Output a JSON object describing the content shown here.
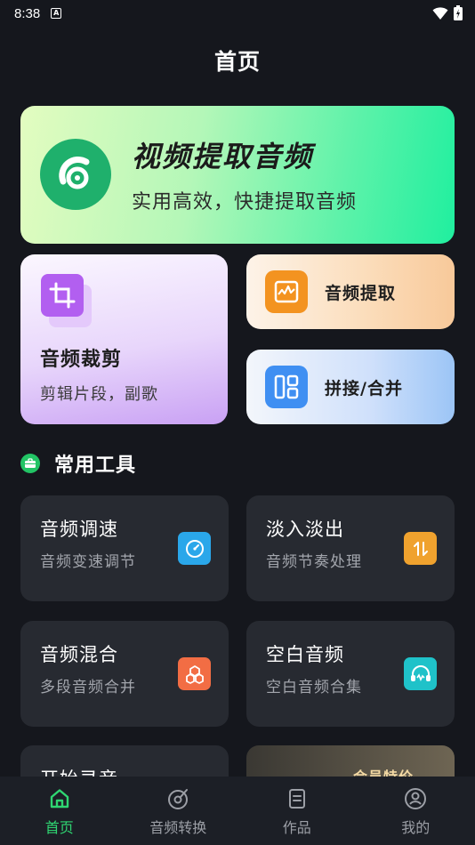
{
  "status": {
    "time": "8:38",
    "notif": "A"
  },
  "page": {
    "title": "首页"
  },
  "hero": {
    "title": "视频提取音频",
    "subtitle": "实用高效，快捷提取音频"
  },
  "feature_cards": {
    "crop": {
      "title": "音频裁剪",
      "subtitle": "剪辑片段，副歌"
    },
    "extract": {
      "label": "音频提取"
    },
    "merge": {
      "label": "拼接/合并"
    }
  },
  "section": {
    "title": "常用工具"
  },
  "tools": [
    {
      "title": "音频调速",
      "subtitle": "音频变速调节",
      "icon": "speed-dial-icon",
      "color": "#2aa7ea"
    },
    {
      "title": "淡入淡出",
      "subtitle": "音频节奏处理",
      "icon": "swap-arrows-icon",
      "color": "#f0a22e"
    },
    {
      "title": "音频混合",
      "subtitle": "多段音频合并",
      "icon": "boxes-icon",
      "color": "#f26d44"
    },
    {
      "title": "空白音频",
      "subtitle": "空白音频合集",
      "icon": "headphones-icon",
      "color": "#1fc2c9"
    },
    {
      "title": "开始录音",
      "subtitle": "",
      "icon": "",
      "color": ""
    },
    {
      "title": "会员特价",
      "subtitle": "",
      "icon": "",
      "color": ""
    }
  ],
  "nav": [
    {
      "label": "首页",
      "icon": "home-icon",
      "active": true
    },
    {
      "label": "音频转换",
      "icon": "disc-icon",
      "active": false
    },
    {
      "label": "作品",
      "icon": "document-icon",
      "active": false
    },
    {
      "label": "我的",
      "icon": "user-icon",
      "active": false
    }
  ],
  "colors": {
    "accent": "#2fd672",
    "background": "#15171d",
    "card": "#272a31"
  }
}
